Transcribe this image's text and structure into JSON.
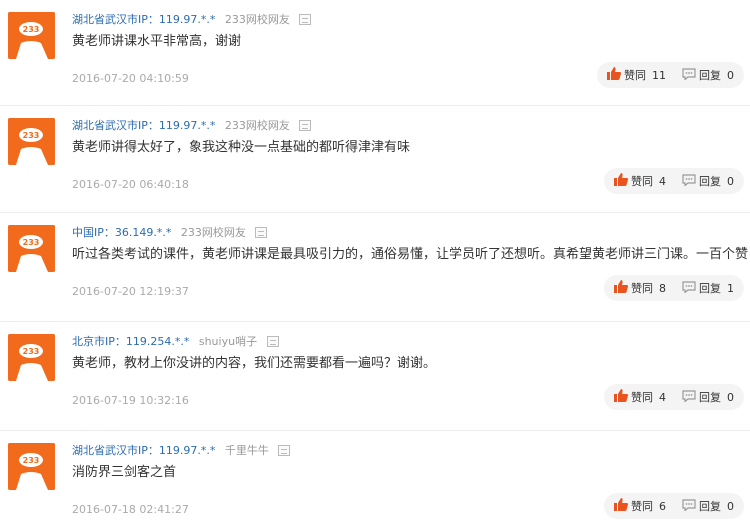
{
  "comments": [
    {
      "location": "湖北省武汉市IP：119.97.*.*",
      "user": "233网校网友",
      "text": "黄老师讲课水平非常高，谢谢",
      "time": "2016-07-20 04:10:59",
      "like_label": "赞同",
      "likes": "11",
      "reply_label": "回复",
      "replies": "0"
    },
    {
      "location": "湖北省武汉市IP：119.97.*.*",
      "user": "233网校网友",
      "text": "黄老师讲得太好了，象我这种没一点基础的都听得津津有味",
      "time": "2016-07-20 06:40:18",
      "like_label": "赞同",
      "likes": "4",
      "reply_label": "回复",
      "replies": "0"
    },
    {
      "location": "中国IP：36.149.*.*",
      "user": "233网校网友",
      "text": "听过各类考试的课件，黄老师讲课是最具吸引力的，通俗易懂，让学员听了还想听。真希望黄老师讲三门课。一百个赞！",
      "time": "2016-07-20 12:19:37",
      "like_label": "赞同",
      "likes": "8",
      "reply_label": "回复",
      "replies": "1"
    },
    {
      "location": "北京市IP：119.254.*.*",
      "user": "shuiyu哨子",
      "text": "黄老师，教材上你没讲的内容，我们还需要都看一遍吗？谢谢。",
      "time": "2016-07-19 10:32:16",
      "like_label": "赞同",
      "likes": "4",
      "reply_label": "回复",
      "replies": "0"
    },
    {
      "location": "湖北省武汉市IP：119.97.*.*",
      "user": "千里牛牛",
      "text": "消防界三剑客之首",
      "time": "2016-07-18 02:41:27",
      "like_label": "赞同",
      "likes": "6",
      "reply_label": "回复",
      "replies": "0"
    }
  ],
  "avatar_label": "233",
  "colors": {
    "avatar": "#f26a1b",
    "like": "#e8531f",
    "link": "#2b6cb0"
  },
  "icons": {
    "avatar": "avatar-233-icon",
    "flag": "report-icon",
    "like": "thumbs-up-icon",
    "reply": "reply-bubble-icon"
  }
}
